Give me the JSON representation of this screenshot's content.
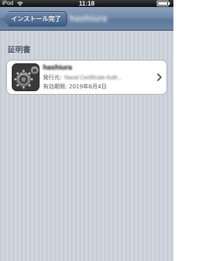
{
  "status_bar": {
    "carrier": "iPod",
    "time": "11:18"
  },
  "nav_bar": {
    "back_label": "インストール完了",
    "title": "hashiura"
  },
  "section": {
    "header": "証明書"
  },
  "certificate": {
    "name": "hashiura",
    "issuer_label": "発行元:",
    "issuer_value": "Naval Certificate Auth...",
    "expiry_label": "有効期限:",
    "expiry_value": "2019年6月4日"
  },
  "colors": {
    "nav_bar": "#6e88a8",
    "background": "#cbd2d9",
    "section_header_text": "#4c566c"
  },
  "icons": {
    "wifi": "wifi-icon",
    "battery": "battery-icon",
    "certificate": "gear-icon",
    "disclosure": "chevron-right-icon"
  }
}
